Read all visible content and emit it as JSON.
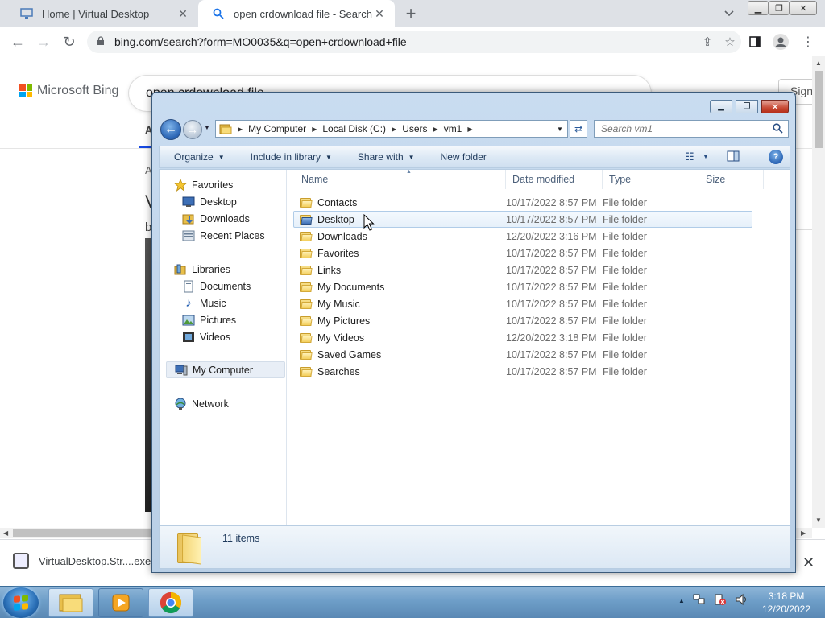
{
  "browser": {
    "tabs": [
      {
        "title": "Home | Virtual Desktop",
        "icon": "monitor-icon",
        "active": false
      },
      {
        "title": "open crdownload file - Search",
        "icon": "search-icon",
        "active": true
      }
    ],
    "url": "bing.com/search?form=MO0035&q=open+crdownload+file"
  },
  "bing": {
    "brand": "Microsoft Bing",
    "query": "open crdownload file",
    "sign_in": "Sign",
    "frag_a1": "A",
    "frag_a2": "A",
    "frag_v": "V",
    "frag_b": "b"
  },
  "download": {
    "filename": "VirtualDesktop.Str....exe"
  },
  "taskbar": {
    "time": "3:18 PM",
    "date": "12/20/2022"
  },
  "explorer": {
    "breadcrumbs": [
      "My Computer",
      "Local Disk (C:)",
      "Users",
      "vm1"
    ],
    "search_placeholder": "Search vm1",
    "commands": [
      {
        "label": "Organize",
        "dropdown": true
      },
      {
        "label": "Include in library",
        "dropdown": true
      },
      {
        "label": "Share with",
        "dropdown": true
      },
      {
        "label": "New folder",
        "dropdown": false
      }
    ],
    "nav": {
      "favorites": "Favorites",
      "desktop": "Desktop",
      "downloads": "Downloads",
      "recent": "Recent Places",
      "libraries": "Libraries",
      "documents": "Documents",
      "music": "Music",
      "pictures": "Pictures",
      "videos": "Videos",
      "computer": "My Computer",
      "network": "Network"
    },
    "columns": [
      "Name",
      "Date modified",
      "Type",
      "Size"
    ],
    "files": [
      {
        "name": "Contacts",
        "date": "10/17/2022 8:57 PM",
        "type": "File folder"
      },
      {
        "name": "Desktop",
        "date": "10/17/2022 8:57 PM",
        "type": "File folder"
      },
      {
        "name": "Downloads",
        "date": "12/20/2022 3:16 PM",
        "type": "File folder"
      },
      {
        "name": "Favorites",
        "date": "10/17/2022 8:57 PM",
        "type": "File folder"
      },
      {
        "name": "Links",
        "date": "10/17/2022 8:57 PM",
        "type": "File folder"
      },
      {
        "name": "My Documents",
        "date": "10/17/2022 8:57 PM",
        "type": "File folder"
      },
      {
        "name": "My Music",
        "date": "10/17/2022 8:57 PM",
        "type": "File folder"
      },
      {
        "name": "My Pictures",
        "date": "10/17/2022 8:57 PM",
        "type": "File folder"
      },
      {
        "name": "My Videos",
        "date": "12/20/2022 3:18 PM",
        "type": "File folder"
      },
      {
        "name": "Saved Games",
        "date": "10/17/2022 8:57 PM",
        "type": "File folder"
      },
      {
        "name": "Searches",
        "date": "10/17/2022 8:57 PM",
        "type": "File folder"
      }
    ],
    "item_count": "11 items"
  },
  "colors": {
    "bing_blue": "#174ae4",
    "ms_red": "#f25022",
    "ms_green": "#7fba00",
    "ms_blue": "#00a4ef",
    "ms_yellow": "#ffb900"
  }
}
